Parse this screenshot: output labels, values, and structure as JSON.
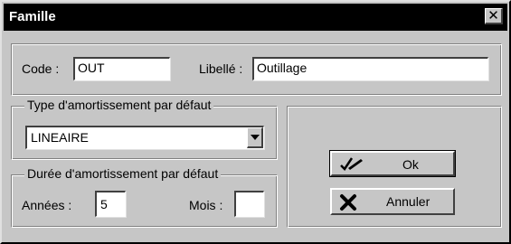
{
  "window": {
    "title": "Famille",
    "close_glyph": "✕"
  },
  "top": {
    "code_label": "Code :",
    "code_value": "OUT",
    "libelle_label": "Libellé :",
    "libelle_value": "Outillage"
  },
  "type_group": {
    "legend": "Type d'amortissement par défaut",
    "selected": "LINEAIRE"
  },
  "duree_group": {
    "legend": "Durée d'amortissement par défaut",
    "annees_label": "Années :",
    "annees_value": "5",
    "mois_label": "Mois :",
    "mois_value": ""
  },
  "buttons": {
    "ok_label": "Ok",
    "ok_icon": "check-pencil-icon",
    "cancel_label": "Annuler",
    "cancel_icon": "x-icon"
  }
}
